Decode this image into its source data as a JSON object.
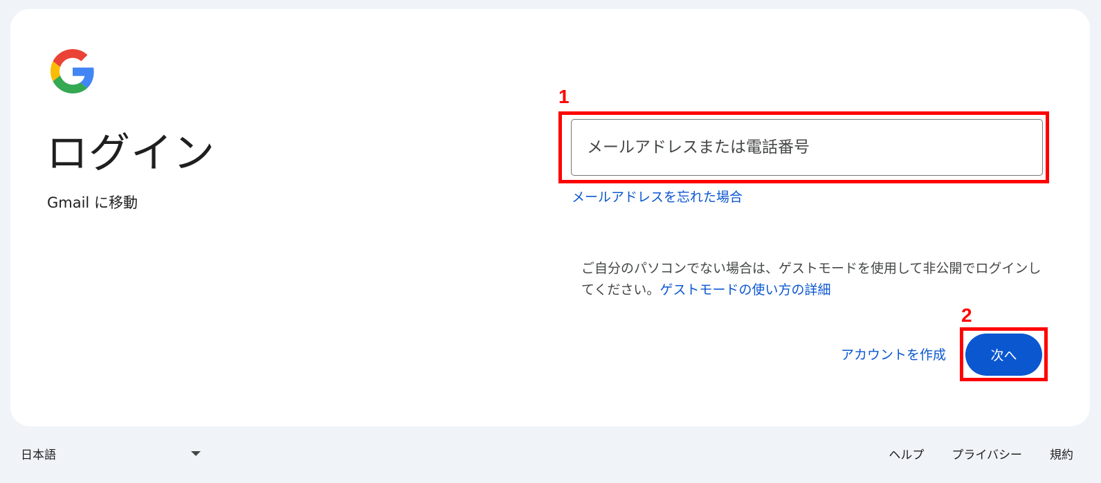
{
  "page": {
    "title": "ログイン",
    "subtitle": "Gmail に移動"
  },
  "logo": {
    "icon": "google-g-icon",
    "colors": [
      "#4285F4",
      "#EA4335",
      "#FBBC05",
      "#34A853"
    ]
  },
  "form": {
    "email_placeholder": "メールアドレスまたは電話番号",
    "email_value": "",
    "forgot_email_link": "メールアドレスを忘れた場合",
    "guest_text": "ご自分のパソコンでない場合は、ゲストモードを使用して非公開でログインしてください。",
    "guest_link": "ゲストモードの使い方の詳細",
    "create_account_label": "アカウントを作成",
    "next_label": "次へ"
  },
  "annotations": {
    "label_1": "1",
    "label_2": "2",
    "color": "#ff0000"
  },
  "footer": {
    "language": "日本語",
    "help": "ヘルプ",
    "privacy": "プライバシー",
    "terms": "規約"
  },
  "theme": {
    "accent": "#0b57d0",
    "background": "#f0f4f9",
    "card": "#ffffff"
  }
}
